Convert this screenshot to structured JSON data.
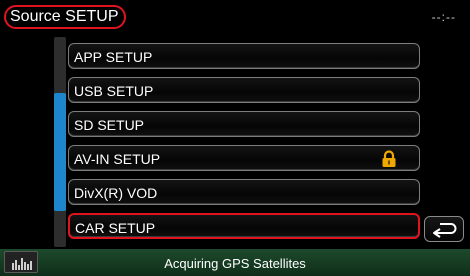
{
  "header": {
    "title": "Source SETUP",
    "clock": "--:--"
  },
  "menu": {
    "items": [
      {
        "label": "APP SETUP"
      },
      {
        "label": "USB SETUP"
      },
      {
        "label": "SD SETUP"
      },
      {
        "label": "AV-IN SETUP",
        "icon": "lock-icon"
      },
      {
        "label": "DivX(R) VOD"
      },
      {
        "label": "CAR SETUP"
      }
    ]
  },
  "scrollbar": {
    "position": 0.28,
    "visible_fraction": 0.56
  },
  "back_button": {
    "icon": "return-arrow-icon"
  },
  "status_bar": {
    "text": "Acquiring GPS Satellites",
    "eq_icon": "equalizer-icon"
  },
  "colors": {
    "highlight": "#e0141e",
    "scroll_thumb": "#1d86cc",
    "lock": "#f0a800",
    "status_bg": "#1d4a2c"
  }
}
